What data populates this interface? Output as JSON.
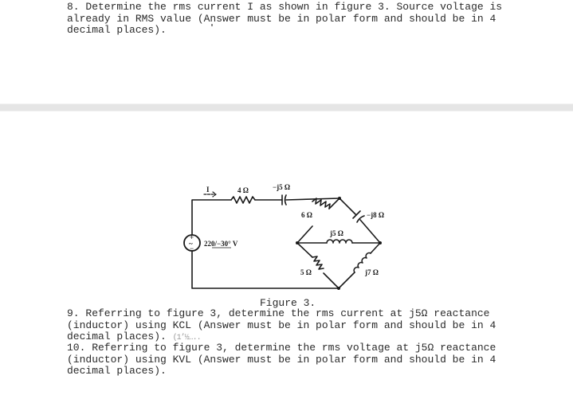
{
  "questions": [
    {
      "number": "8",
      "lines": [
        "8. Determine the rms current I as shown in figure 3. Source voltage is",
        "already in RMS value (Answer must be in polar form and should be in 4",
        "decimal places)."
      ]
    },
    {
      "number": "9",
      "lines": [
        "9. Referring to figure 3, determine the rms current at j5Ω reactance",
        "(inductor) using KCL (Answer must be in polar form and should be in 4",
        "decimal places). "
      ],
      "artifact": "(1’½….."
    },
    {
      "number": "10",
      "lines": [
        "10. Referring to figure 3, determine the rms voltage at j5Ω reactance",
        "(inductor) using KVL (Answer must be in polar form and should be in 4",
        "decimal places)."
      ]
    }
  ],
  "figure": {
    "caption": "Figure 3.",
    "current_label": "I",
    "source": {
      "label": "220/−30° V",
      "magnitude": "220",
      "angle": "−30°",
      "unit": "V",
      "plus": "+",
      "minus": "−",
      "symbol": "~"
    },
    "components": {
      "r4": "4 Ω",
      "c5": "−j5 Ω",
      "r6": "6 Ω",
      "c8": "−j8 Ω",
      "l5": "j5 Ω",
      "r5": "5 Ω",
      "l7": "j7 Ω"
    }
  },
  "colors": {
    "text": "#2a2a2a",
    "separator": "#e5e5e5",
    "ink": "#1a1a1a"
  }
}
